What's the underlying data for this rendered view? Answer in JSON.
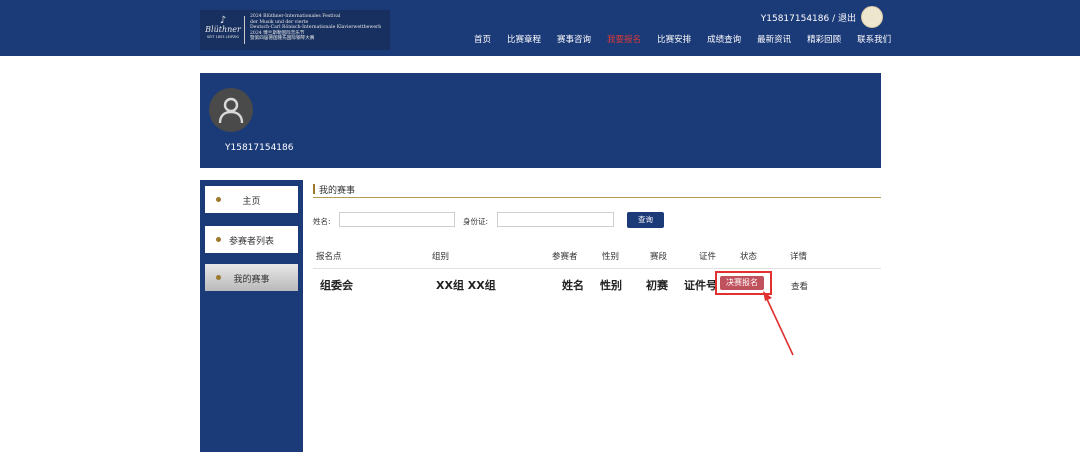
{
  "header": {
    "logo_lines": [
      "2024 Blüthner-Internationales Festival",
      "der Musik und der vierte",
      "Deutsch-Carl Rönisch-Internationale Klavierwettbewerb",
      "2024 博兰斯勒国际音乐节",
      "暨第四届德国隆氏国际钢琴大赛"
    ],
    "logo_brand": "Blüthner",
    "logo_sub": "SEIT 1853 LEIPZIG",
    "user_text": "Y15817154186 / 退出",
    "nav": [
      "首页",
      "比赛章程",
      "赛事咨询",
      "我要报名",
      "比赛安排",
      "成绩查询",
      "最新资讯",
      "精彩回顾",
      "联系我们"
    ],
    "active_nav": "我要报名"
  },
  "banner": {
    "username": "Y15817154186"
  },
  "sidebar": {
    "items": [
      {
        "label": "主页"
      },
      {
        "label": "参赛者列表"
      },
      {
        "label": "我的赛事"
      }
    ]
  },
  "main": {
    "section_title": "我的赛事",
    "search": {
      "name_label": "姓名:",
      "id_label": "身份证:",
      "query_button": "查询"
    },
    "columns": [
      "报名点",
      "组别",
      "参赛者",
      "性别",
      "赛段",
      "证件",
      "状态",
      "详情"
    ],
    "row": {
      "site": "组委会",
      "group": "XX组 XX组",
      "name": "姓名",
      "gender": "性别",
      "stage": "初赛",
      "cert": "证件号",
      "status": "决赛报名",
      "detail": "查看"
    }
  },
  "colors": {
    "navy": "#1b3a78",
    "accent_gold": "#9b7a2e",
    "active_red": "#d73a3a",
    "badge": "#c0525e",
    "highlight": "#e03030"
  }
}
